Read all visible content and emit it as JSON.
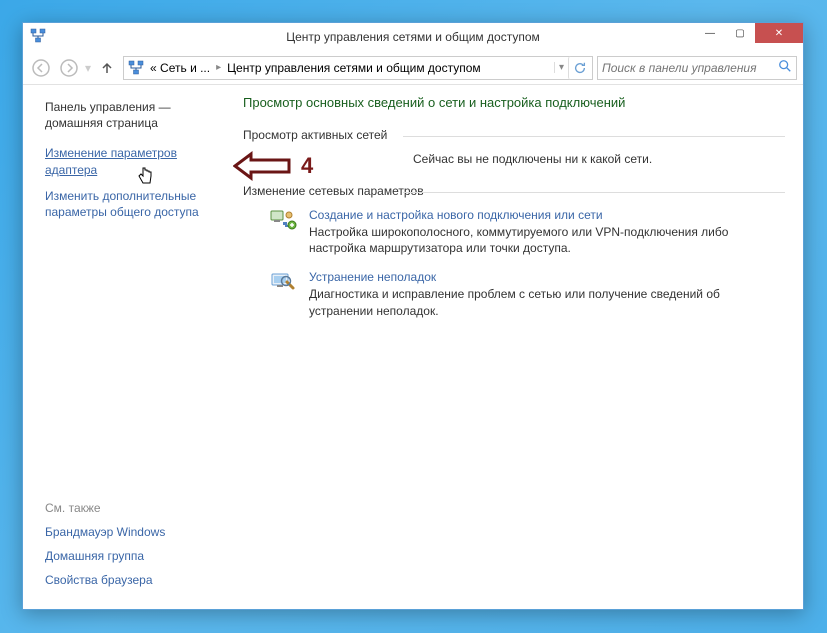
{
  "title": "Центр управления сетями и общим доступом",
  "breadcrumb": {
    "seg1": "« Сеть и ...",
    "seg2": "Центр управления сетями и общим доступом"
  },
  "search": {
    "placeholder": "Поиск в панели управления"
  },
  "sidebar": {
    "home": "Панель управления — домашняя страница",
    "links": [
      "Изменение параметров адаптера",
      "Изменить дополнительные параметры общего доступа"
    ],
    "seealso_title": "См. также",
    "seealso": [
      "Брандмауэр Windows",
      "Домашняя группа",
      "Свойства браузера"
    ]
  },
  "main": {
    "heading": "Просмотр основных сведений о сети и настройка подключений",
    "section1_title": "Просмотр активных сетей",
    "status": "Сейчас вы не подключены ни к какой сети.",
    "section2_title": "Изменение сетевых параметров",
    "blocks": [
      {
        "title": "Создание и настройка нового подключения или сети",
        "desc": "Настройка широкополосного, коммутируемого или VPN-подключения либо настройка маршрутизатора или точки доступа."
      },
      {
        "title": "Устранение неполадок",
        "desc": "Диагностика и исправление проблем с сетью или получение сведений об устранении неполадок."
      }
    ]
  },
  "annotation": {
    "number": "4"
  },
  "window_controls": {
    "min": "—",
    "max": "▢",
    "close": "✕"
  }
}
